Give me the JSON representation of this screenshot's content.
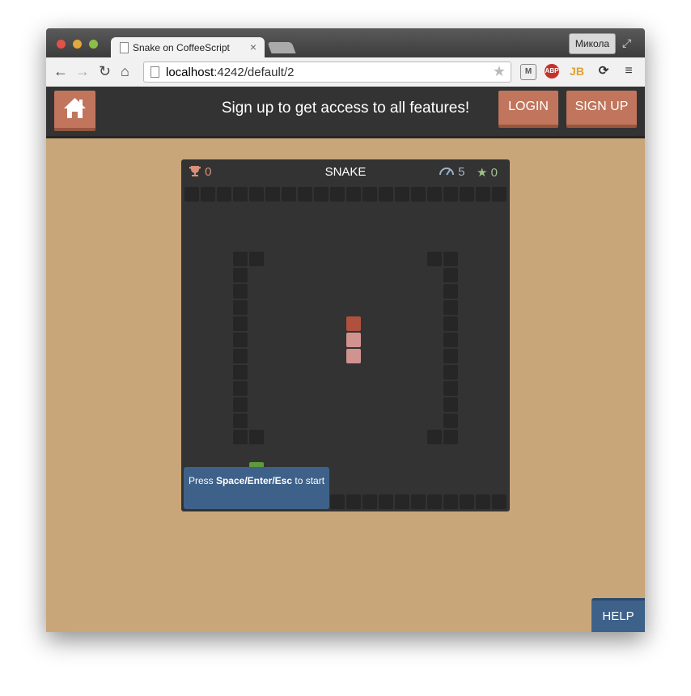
{
  "browser": {
    "tab_title": "Snake on CoffeeScript",
    "tab_close": "×",
    "user_label": "Микола",
    "url_host": "localhost",
    "url_path": ":4242/default/2",
    "ext_abp": "ABP",
    "ext_jb": "JB"
  },
  "header": {
    "banner": "Sign up to get access to all features!",
    "login_label": "LOGIN",
    "signup_label": "SIGN UP"
  },
  "game": {
    "title": "SNAKE",
    "trophy_count": "0",
    "speed": "5",
    "stars": "0",
    "prompt_before": "Press ",
    "prompt_keys": "Space/Enter/Esc",
    "prompt_after": " to start"
  },
  "help_label": "HELP",
  "colors": {
    "page_bg": "#c9a679",
    "header_bg": "#333333",
    "accent": "#c0755c",
    "board_bg": "#333333",
    "wall": "#262626",
    "snake_head": "#b0513e",
    "snake_body": "#d19390",
    "food": "#5e9a3d",
    "info_blue": "#3e6189"
  }
}
